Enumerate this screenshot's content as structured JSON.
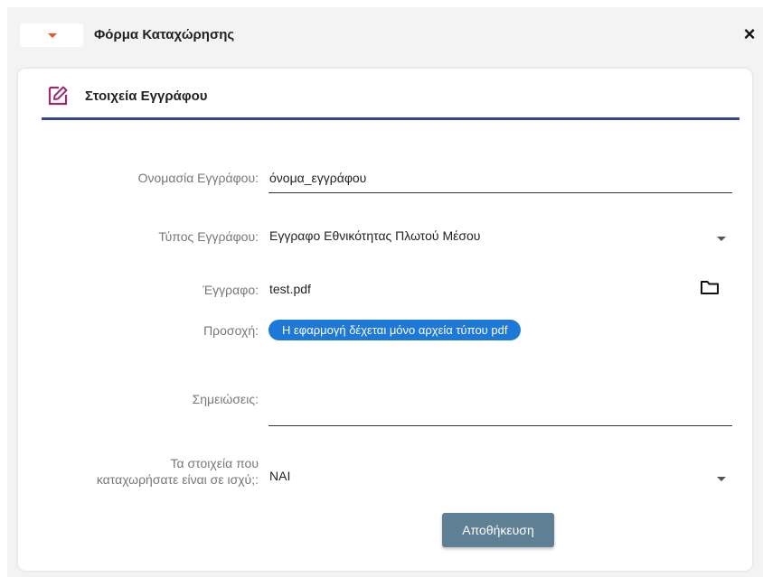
{
  "dialog": {
    "title": "Φόρμα Καταχώρησης",
    "close_label": "×",
    "collapse_icon": "caret-down-icon",
    "accent_color": "#e8532f"
  },
  "section": {
    "title": "Στοιχεία Εγγράφου",
    "icon": "edit-icon",
    "icon_color": "#9b2a6f",
    "rule_color": "#2e4a8a"
  },
  "form": {
    "name_label": "Ονομασία Εγγράφου:",
    "name_value": "όνομα_εγγράφου",
    "type_label": "Τύπος Εγγράφου:",
    "type_value": "Εγγραφο Εθνικότητας Πλωτού Μέσου",
    "file_label": "Έγγραφο:",
    "file_value": "test.pdf",
    "file_icon": "folder-icon",
    "warning_label": "Προσοχή:",
    "warning_text": "Η εφαρμογή δέχεται μόνο αρχεία τύπου pdf",
    "warning_color": "#1e78d7",
    "notes_label": "Σημειώσεις:",
    "notes_value": "",
    "valid_label_line1": "Τα στοιχεία που",
    "valid_label_line2": "καταχωρήσατε είναι σε ισχύ;:",
    "valid_value": "ΝΑΙ"
  },
  "actions": {
    "save_label": "Αποθήκευση",
    "save_color": "#5f7f95"
  }
}
